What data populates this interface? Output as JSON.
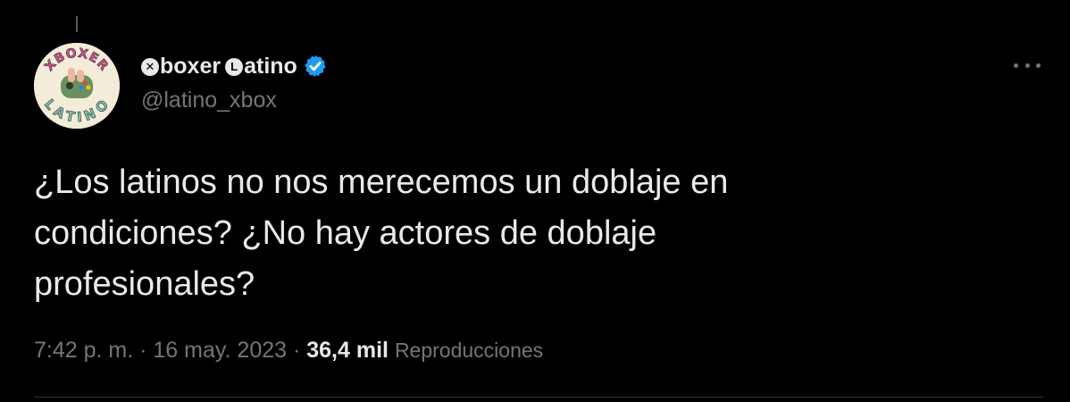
{
  "colors": {
    "background": "#000000",
    "text_primary": "#e7e9ea",
    "text_secondary": "#71767b",
    "verified_badge": "#1d9bf0",
    "divider": "#2f3336"
  },
  "author": {
    "display_name_parts": [
      "boxer",
      "atino"
    ],
    "display_name_glyphs": [
      "✕",
      "L"
    ],
    "handle": "@latino_xbox",
    "verified": true,
    "avatar_text": [
      "XBOXER",
      "LATINO"
    ]
  },
  "tweet": {
    "lines": [
      "¿Los latinos no nos merecemos un doblaje en",
      "condiciones? ¿No hay actores de doblaje",
      "profesionales?"
    ]
  },
  "meta": {
    "time": "7:42 p. m.",
    "separator": " · ",
    "date": "16 may. 2023",
    "views_count": "36,4 mil",
    "views_label": "Reproducciones"
  },
  "icons": {
    "more": "more-horizontal-icon",
    "verified": "verified-badge-icon"
  }
}
